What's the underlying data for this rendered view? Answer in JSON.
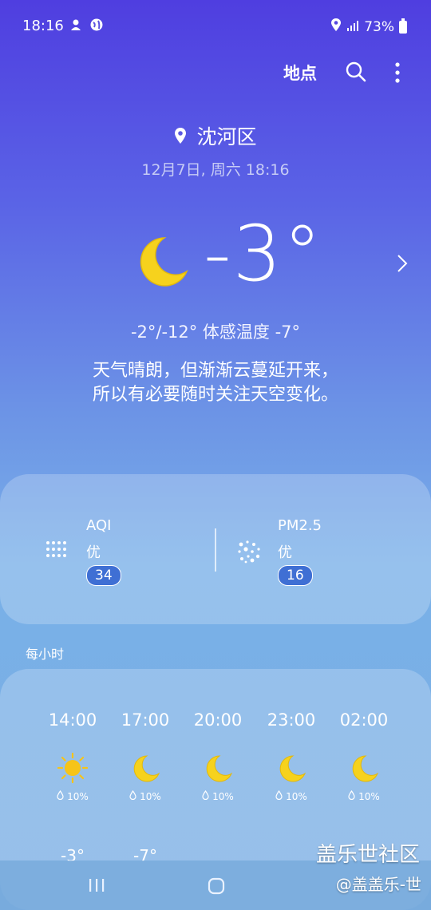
{
  "status_bar": {
    "time": "18:16",
    "battery": "73%"
  },
  "header": {
    "location_button": "地点"
  },
  "location": {
    "name": "沈河区",
    "datetime": "12月7日, 周六 18:16"
  },
  "current": {
    "temperature": "-3°",
    "range_feels": "-2°/-12° 体感温度 -7°",
    "description_line1": "天气晴朗，但渐渐云蔓延开来，",
    "description_line2": "所以有必要随时关注天空变化。"
  },
  "air": {
    "aqi": {
      "label": "AQI",
      "level": "优",
      "value": "34"
    },
    "pm25": {
      "label": "PM2.5",
      "level": "优",
      "value": "16"
    }
  },
  "hourly": {
    "title": "每小时",
    "items": [
      {
        "time": "14:00",
        "icon": "sun-icon",
        "precip": "10%",
        "temp": "-3°"
      },
      {
        "time": "17:00",
        "icon": "moon-icon",
        "precip": "10%",
        "temp": "-7°"
      },
      {
        "time": "20:00",
        "icon": "moon-icon",
        "precip": "10%",
        "temp": ""
      },
      {
        "time": "23:00",
        "icon": "moon-icon",
        "precip": "10%",
        "temp": ""
      },
      {
        "time": "02:00",
        "icon": "moon-icon",
        "precip": "10%",
        "temp": ""
      }
    ]
  },
  "watermark": {
    "line1": "盖乐世社区",
    "line2": "@盖盖乐-世"
  },
  "colors": {
    "moon": "#f6d21d",
    "sun": "#f6c418",
    "pill": "#3f6fd4"
  }
}
